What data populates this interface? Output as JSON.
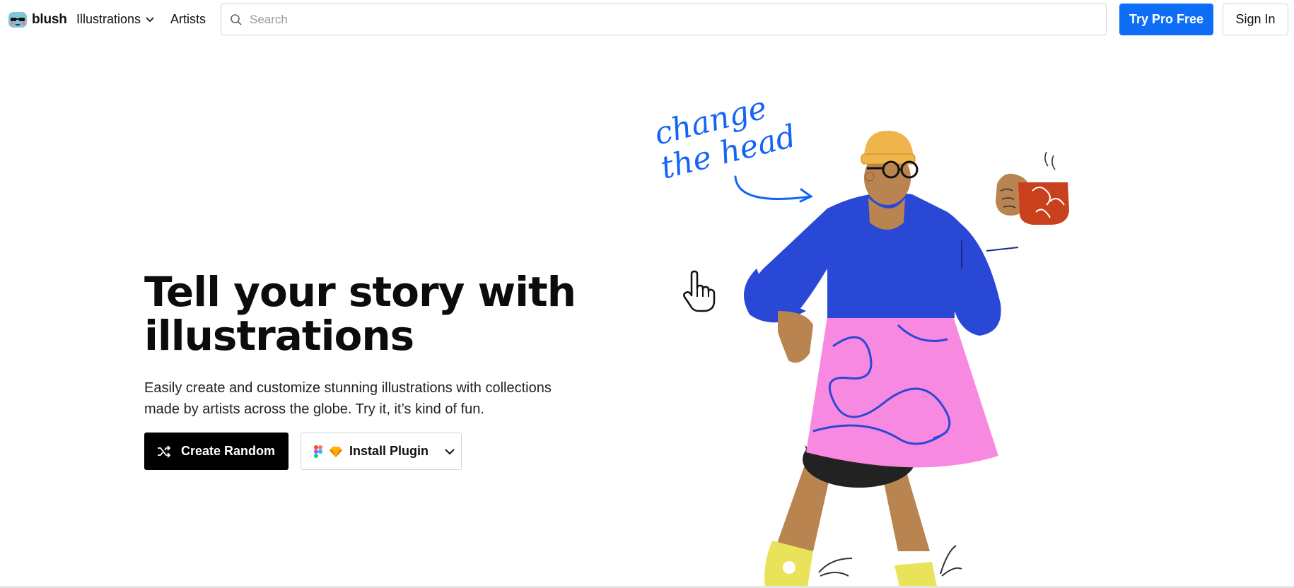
{
  "header": {
    "logo_text": "blush",
    "nav_illustrations": "Illustrations",
    "nav_artists": "Artists",
    "search_placeholder": "Search",
    "try_pro": "Try Pro Free",
    "sign_in": "Sign In"
  },
  "hero": {
    "title": "Tell your story with illustrations",
    "subtitle": "Easily create and customize stunning illustrations with collections made by artists across the globe. Try it, it’s kind of fun.",
    "create_random": "Create Random",
    "install_plugin": "Install Plugin"
  },
  "illustration": {
    "annotation_line1": "change",
    "annotation_line2": "the head"
  },
  "colors": {
    "accent": "#0f6ef7",
    "sweater": "#2a48d6",
    "skirt": "#f78ae0",
    "skin": "#b9844f",
    "hat": "#f0b54a",
    "mug": "#c8401c",
    "shoes": "#e8e35a",
    "scribble": "#1565f5"
  },
  "icons": [
    "blush-logo-icon",
    "chevron-down-icon",
    "search-icon",
    "shuffle-icon",
    "figma-icon",
    "sketch-icon",
    "hand-cursor-icon"
  ]
}
